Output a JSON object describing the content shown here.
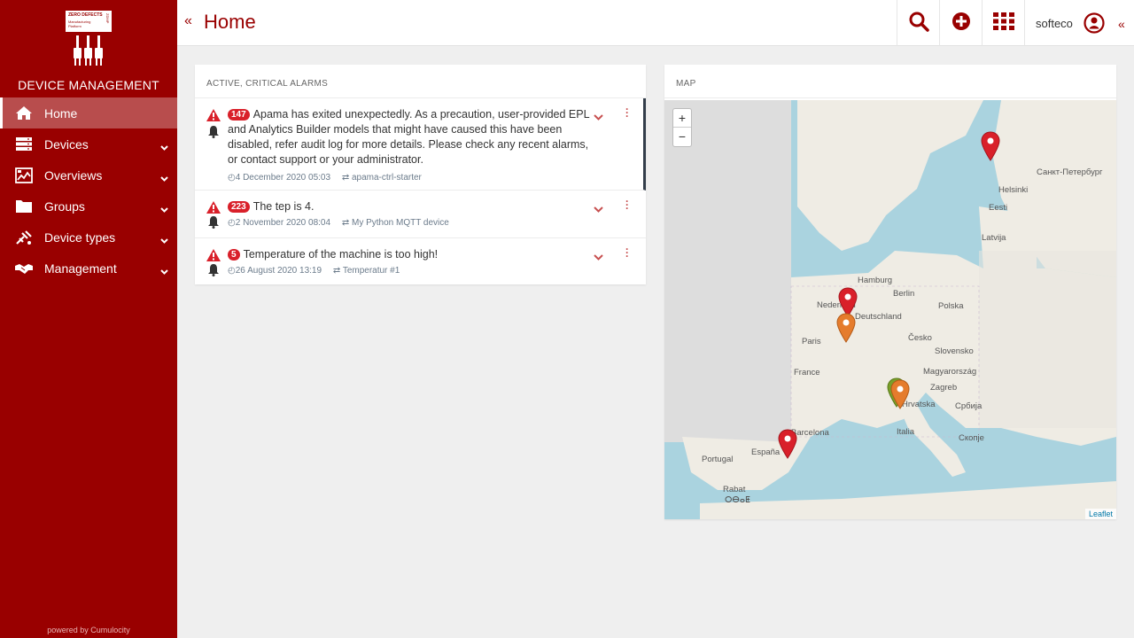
{
  "brand": {
    "logo_line1": "ZERO DEFECTS",
    "logo_line2": "Manufacturing Platform",
    "logo_side": "ZDMP",
    "title": "DEVICE MANAGEMENT"
  },
  "nav": {
    "items": [
      {
        "label": "Home",
        "icon": "home-icon",
        "active": true
      },
      {
        "label": "Devices",
        "icon": "devices-icon"
      },
      {
        "label": "Overviews",
        "icon": "overviews-icon"
      },
      {
        "label": "Groups",
        "icon": "folder-icon"
      },
      {
        "label": "Device types",
        "icon": "device-types-icon"
      },
      {
        "label": "Management",
        "icon": "handshake-icon"
      }
    ],
    "powered": "powered by Cumulocity"
  },
  "header": {
    "collapse_left": "«",
    "title": "Home",
    "user": "softeco",
    "collapse_right": "«"
  },
  "alarms": {
    "title": "ACTIVE, CRITICAL ALARMS",
    "items": [
      {
        "count": "147",
        "message": "Apama has exited unexpectedly. As a precaution, user-provided EPL and Analytics Builder models that might have caused this have been disabled, refer audit log for more details. Please check any recent alarms, or contact support or your administrator.",
        "time": "4 December 2020 05:03",
        "source": "apama-ctrl-starter"
      },
      {
        "count": "223",
        "message": "The tep is 4.",
        "time": "2 November 2020 08:04",
        "source": "My Python MQTT device"
      },
      {
        "count": "5",
        "message": "Temperature of the machine is too high!",
        "time": "26 August 2020 13:19",
        "source": "Temperatur #1"
      }
    ]
  },
  "map": {
    "title": "MAP",
    "zoom_in": "+",
    "zoom_out": "−",
    "attribution": "Leaflet",
    "labels": [
      "Helsinki",
      "Санкт-Петербург",
      "Eesti",
      "Latvija",
      "Hamburg",
      "Berlin",
      "Nederland",
      "Deutschland",
      "Polska",
      "Paris",
      "Česko",
      "Slovensko",
      "France",
      "Magyarország",
      "Zagreb",
      "Hrvatska",
      "Србија",
      "Italia",
      "Скопје",
      "Barcelona",
      "España",
      "Portugal",
      "Rabat",
      "ⵔⴱⴰⵟ"
    ],
    "marker_colors": {
      "critical": "#d9202a",
      "major": "#e57c2d",
      "minor": "#7a9f2a"
    }
  }
}
